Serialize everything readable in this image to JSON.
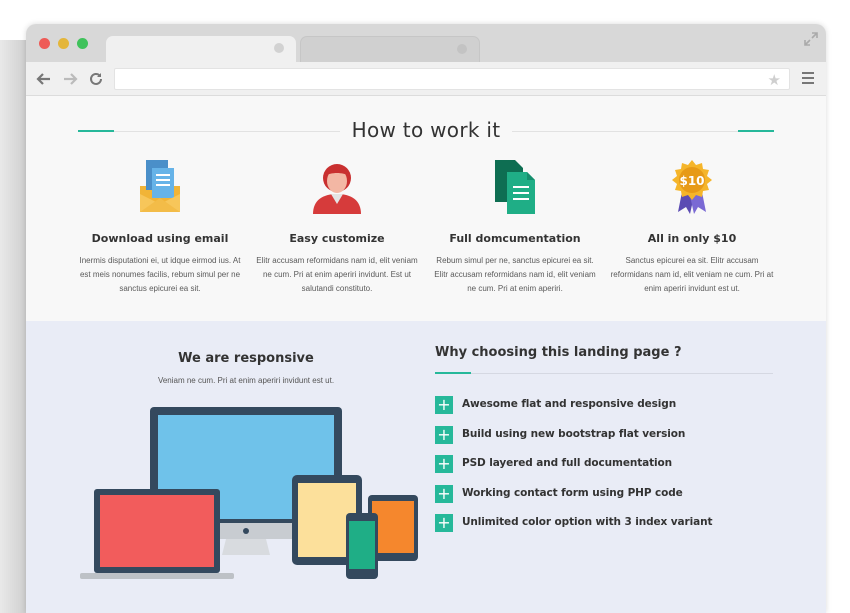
{
  "browser": {
    "address": ""
  },
  "how_to": {
    "title": "How to work it",
    "features": [
      {
        "icon": "email-icon",
        "title": "Download using email",
        "text": "Inermis disputationi ei, ut idque eirmod ius. At est meis nonumes facilis, rebum simul per ne sanctus epicurei ea sit."
      },
      {
        "icon": "user-icon",
        "title": "Easy customize",
        "text": "Elitr accusam reformidans nam id, elit veniam ne cum. Pri at enim aperiri invidunt. Est ut salutandi constituto."
      },
      {
        "icon": "documents-icon",
        "title": "Full domcumentation",
        "text": "Rebum simul per ne, sanctus epicurei ea sit. Elitr accusam reformidans nam id, elit veniam ne cum. Pri at enim aperiri."
      },
      {
        "icon": "price-badge-icon",
        "title": "All in only $10",
        "badge": "$10",
        "text": "Sanctus epicurei ea sit. Elitr accusam reformidans nam id, elit veniam ne cum. Pri at enim aperiri invidunt est ut."
      }
    ]
  },
  "responsive": {
    "title": "We are responsive",
    "subtitle": "Veniam ne cum. Pri at enim aperiri invidunt est ut."
  },
  "why": {
    "title": "Why choosing this landing page ?",
    "items": [
      "Awesome flat and responsive design",
      "Build using new bootstrap flat version",
      "PSD layered and full documentation",
      "Working contact form using PHP code",
      "Unlimited color option with 3 index variant"
    ]
  },
  "colors": {
    "accent": "#26b89a",
    "lower_background": "#e9ecf6"
  }
}
